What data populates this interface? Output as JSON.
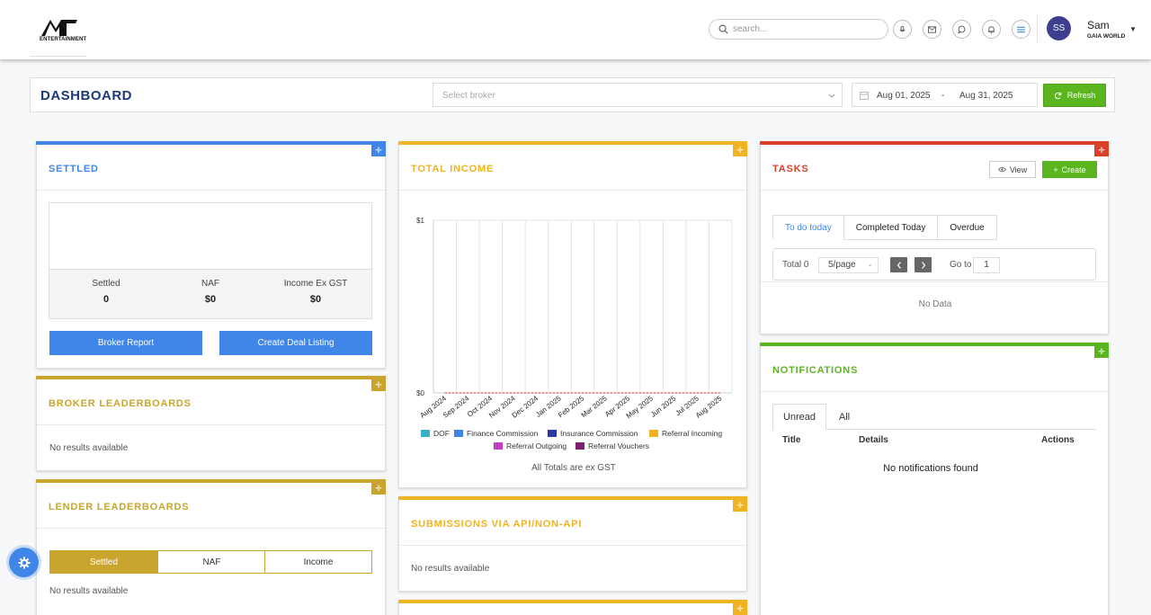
{
  "brand": {
    "logo_text": "ENTERTAINMENT"
  },
  "header": {
    "search_placeholder": "search...",
    "user": {
      "initials": "SS",
      "name": "Sam",
      "org": "GAIA WORLD"
    }
  },
  "dashboard": {
    "title": "DASHBOARD",
    "broker_placeholder": "Select broker",
    "date_from": "Aug 01, 2025",
    "date_sep": "-",
    "date_to": "Aug 31, 2025",
    "refresh_label": "Refresh"
  },
  "settled": {
    "title": "SETTLED",
    "stats": [
      {
        "label": "Settled",
        "value": "0"
      },
      {
        "label": "NAF",
        "value": "$0"
      },
      {
        "label": "Income Ex GST",
        "value": "$0"
      }
    ],
    "broker_report_label": "Broker Report",
    "create_deal_label": "Create Deal Listing"
  },
  "broker_leaderboards": {
    "title": "BROKER LEADERBOARDS",
    "empty": "No results available"
  },
  "lender_leaderboards": {
    "title": "LENDER LEADERBOARDS",
    "segments": [
      "Settled",
      "NAF",
      "Income"
    ],
    "empty": "No results available"
  },
  "total_income": {
    "title": "TOTAL INCOME",
    "footnote": "All Totals are ex GST"
  },
  "chart_data": {
    "type": "line",
    "title": "",
    "xlabel": "",
    "ylabel": "",
    "categories": [
      "Aug 2024",
      "Sep 2024",
      "Oct 2024",
      "Nov 2024",
      "Dec 2024",
      "Jan 2025",
      "Feb 2025",
      "Mar 2025",
      "Apr 2025",
      "May 2025",
      "Jun 2025",
      "Jul 2025",
      "Aug 2025"
    ],
    "y_tick_labels": [
      "$1",
      "$0"
    ],
    "ylim": [
      0,
      1
    ],
    "grid": true,
    "legend_position": "bottom",
    "series": [
      {
        "name": "DOF",
        "color": "#3ab0c8",
        "values": [
          0,
          0,
          0,
          0,
          0,
          0,
          0,
          0,
          0,
          0,
          0,
          0,
          0
        ]
      },
      {
        "name": "Finance Commission",
        "color": "#3f86e8",
        "values": [
          0,
          0,
          0,
          0,
          0,
          0,
          0,
          0,
          0,
          0,
          0,
          0,
          0
        ]
      },
      {
        "name": "Insurance Commission",
        "color": "#2b3aa0",
        "values": [
          0,
          0,
          0,
          0,
          0,
          0,
          0,
          0,
          0,
          0,
          0,
          0,
          0
        ]
      },
      {
        "name": "Referral Incoming",
        "color": "#f0b323",
        "values": [
          0,
          0,
          0,
          0,
          0,
          0,
          0,
          0,
          0,
          0,
          0,
          0,
          0
        ]
      },
      {
        "name": "Referral Outgoing",
        "color": "#c43cc0",
        "values": [
          0,
          0,
          0,
          0,
          0,
          0,
          0,
          0,
          0,
          0,
          0,
          0,
          0
        ]
      },
      {
        "name": "Referral Vouchers",
        "color": "#7a1f6e",
        "values": [
          0,
          0,
          0,
          0,
          0,
          0,
          0,
          0,
          0,
          0,
          0,
          0,
          0
        ]
      }
    ]
  },
  "submissions": {
    "title": "SUBMISSIONS VIA API/NON-API",
    "empty": "No results available"
  },
  "tasks": {
    "title": "TASKS",
    "view_label": "View",
    "create_label": "Create",
    "tabs": [
      "To do today",
      "Completed Today",
      "Overdue"
    ],
    "total_label": "Total 0",
    "page_size": "5/page",
    "goto_label": "Go to",
    "goto_value": "1",
    "empty": "No Data"
  },
  "notifications": {
    "title": "NOTIFICATIONS",
    "tabs": [
      "Unread",
      "All"
    ],
    "columns": [
      "Title",
      "Details",
      "Actions"
    ],
    "empty": "No notifications found"
  },
  "colors": {
    "blue": "#3f86e8",
    "gold": "#c9a52e",
    "yellow": "#f0b323",
    "red": "#d9412b",
    "green": "#5bb51f",
    "navy": "#1c3a78"
  }
}
